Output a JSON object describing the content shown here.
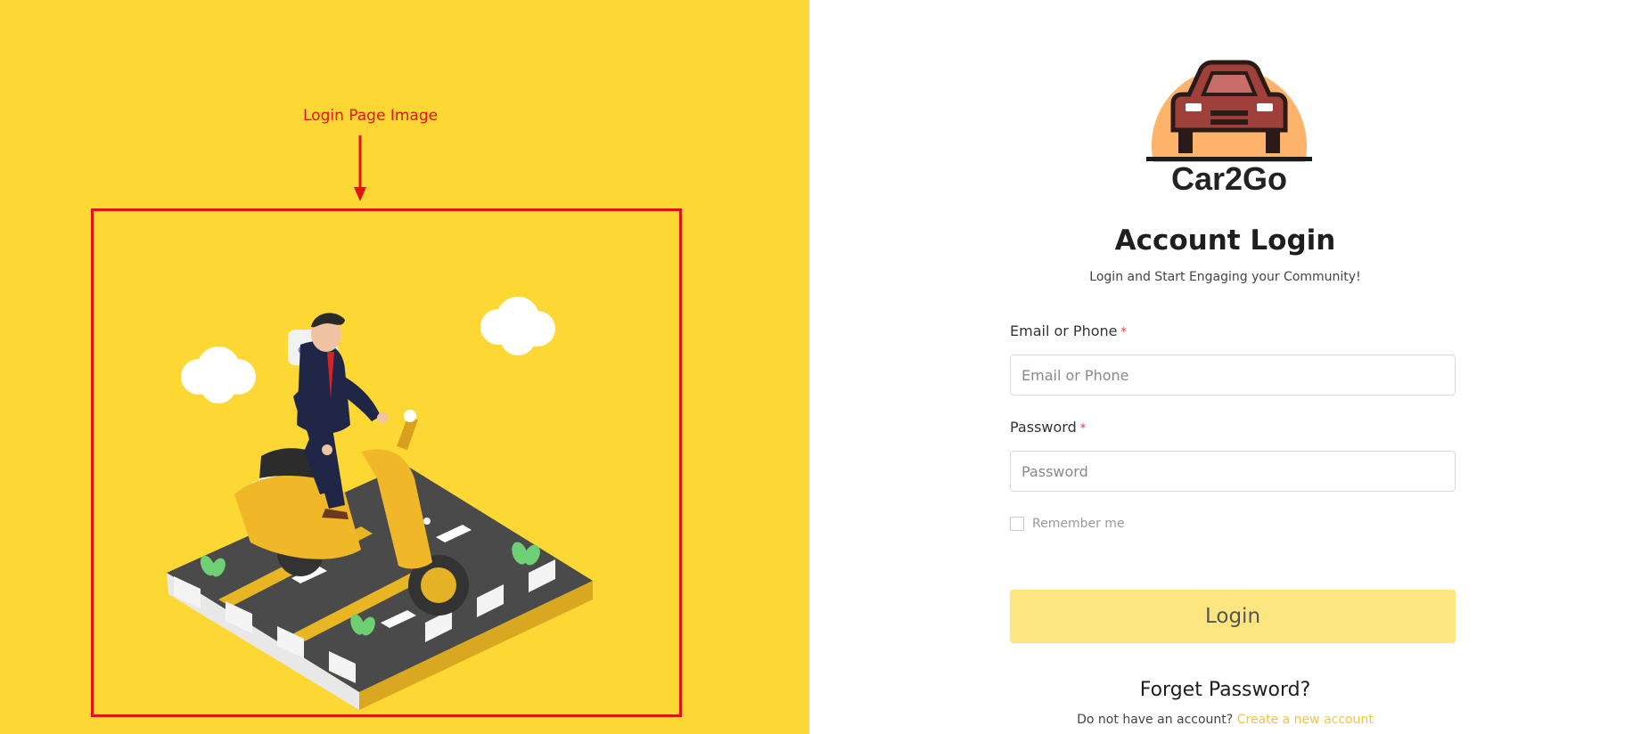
{
  "annotation": {
    "label": "Login Page Image",
    "color": "#e3120b"
  },
  "brand": {
    "name": "Car2Go",
    "logo_icon": "car-logo-icon",
    "accent_color": "#FDD835"
  },
  "login": {
    "title": "Account Login",
    "subtitle": "Login and Start Engaging your Community!",
    "email_label": "Email or Phone",
    "email_placeholder": "Email or Phone",
    "password_label": "Password",
    "password_placeholder": "Password",
    "required_marker": "*",
    "remember_label": "Remember me",
    "remember_checked": false,
    "submit_label": "Login",
    "forgot_label": "Forget Password?",
    "signup_prompt": "Do not have an account?",
    "signup_link": "Create a new account"
  }
}
